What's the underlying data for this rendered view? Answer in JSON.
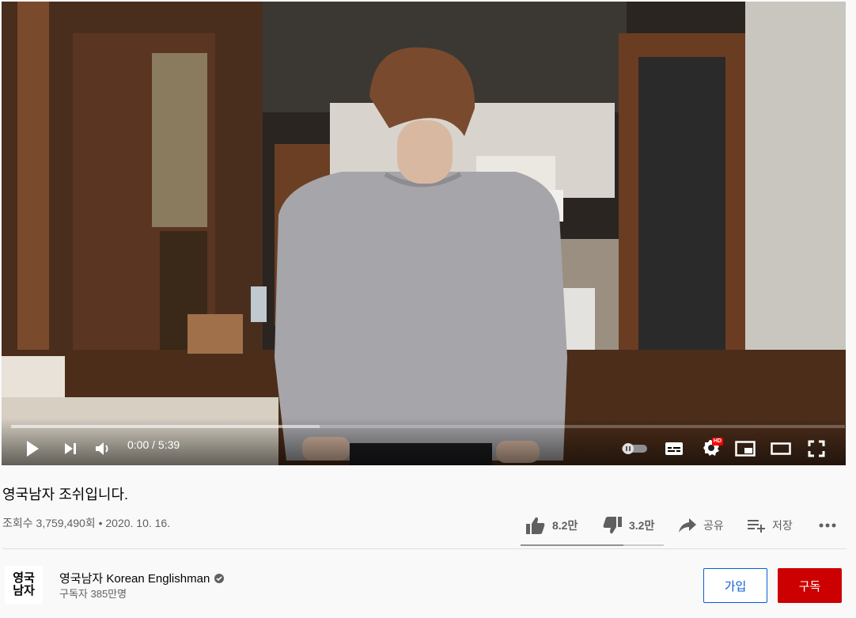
{
  "player": {
    "time_current": "0:00",
    "time_total": "5:39",
    "time_display": "0:00 / 5:39",
    "progress_played": 0.0,
    "progress_loaded": 0.37,
    "hd_badge": "HD",
    "icons": [
      "play-icon",
      "next-icon",
      "volume-icon",
      "autoplay-toggle-icon",
      "subtitles-icon",
      "settings-icon",
      "miniplayer-icon",
      "theater-icon",
      "fullscreen-icon"
    ]
  },
  "video": {
    "title": "영국남자 조쉬입니다.",
    "meta": "조회수 3,759,490회 • 2020. 10. 16.",
    "likes": "8.2만",
    "dislikes": "3.2만",
    "share_label": "공유",
    "save_label": "저장",
    "like_ratio": 0.72
  },
  "channel": {
    "avatar_text_top": "영국",
    "avatar_text_bottom": "남자",
    "name": "영국남자 Korean Englishman",
    "subscribers": "구독자 385만명",
    "join_label": "가입",
    "subscribe_label": "구독"
  },
  "colors": {
    "accent_red": "#cc0000",
    "progress_red": "#ff0000",
    "join_blue": "#065fd4"
  }
}
